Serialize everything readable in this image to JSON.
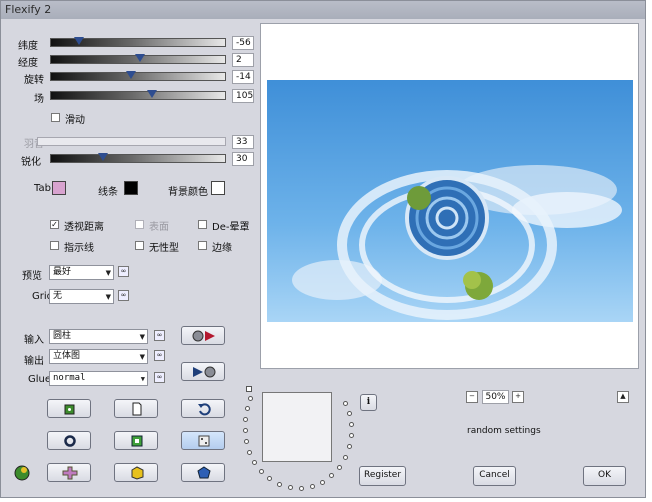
{
  "window": {
    "title": "Flexify 2"
  },
  "sliders": [
    {
      "label": "纬度",
      "value": "-56",
      "fraction": 0.16,
      "enabled": true
    },
    {
      "label": "经度",
      "value": "2",
      "fraction": 0.51,
      "enabled": true
    },
    {
      "label": "旋转",
      "value": "-14",
      "fraction": 0.46,
      "enabled": true
    },
    {
      "label": "场",
      "value": "105",
      "fraction": 0.58,
      "enabled": true
    }
  ],
  "smooth": {
    "label": "滑动",
    "checked": false
  },
  "feather": {
    "label": "羽音",
    "value": "33",
    "fraction": 0.0,
    "enabled": false
  },
  "sharpen": {
    "label": "锐化",
    "value": "30",
    "fraction": 0.3,
    "enabled": true
  },
  "colors": {
    "tab": {
      "label": "Tab",
      "color": "#d8a3cf"
    },
    "lines": {
      "label": "线条",
      "color": "#000000"
    },
    "background": {
      "label": "背景颜色",
      "color": "#ffffff"
    }
  },
  "options": [
    {
      "label": "透视距离",
      "checked": true,
      "enabled": true
    },
    {
      "label": "表面",
      "checked": false,
      "enabled": false
    },
    {
      "label": "De-晕罩",
      "checked": false,
      "enabled": true
    },
    {
      "label": "指示线",
      "checked": false,
      "enabled": true
    },
    {
      "label": "无性型",
      "checked": false,
      "enabled": true
    },
    {
      "label": "边缘",
      "checked": false,
      "enabled": true
    }
  ],
  "preview": {
    "label": "预览",
    "value": "最好"
  },
  "grid": {
    "label": "Grid",
    "value": "无"
  },
  "input": {
    "label": "输入",
    "value": "圆柱"
  },
  "output": {
    "label": "输出",
    "value": "立体图"
  },
  "glue": {
    "label": "Glue",
    "value": "normal"
  },
  "mini_symbol": "∞",
  "zoom": {
    "value": "50%",
    "minus": "−",
    "plus": "+"
  },
  "info_label": "i",
  "status_text": "random settings",
  "buttons": {
    "register": "Register",
    "cancel": "Cancel",
    "ok": "OK"
  },
  "accent": "#2e4d90"
}
